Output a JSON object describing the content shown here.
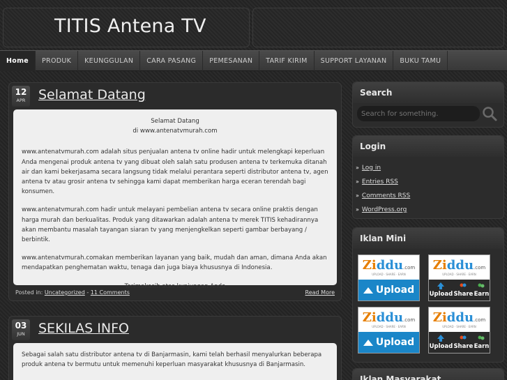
{
  "site": {
    "title": "TITIS Antena TV"
  },
  "nav": {
    "items": [
      "Home",
      "PRODUK",
      "KEUNGGULAN",
      "CARA PASANG",
      "PEMESANAN",
      "TARIF KIRIM",
      "SUPPORT LAYANAN",
      "BUKU TAMU"
    ],
    "active": "Home"
  },
  "posts": [
    {
      "day": "12",
      "month": "APR",
      "title": "Selamat Datang",
      "greeting_1": "Selamat Datang",
      "greeting_2": "di www.antenatvmurah.com",
      "para_1": "www.antenatvmurah.com adalah situs penjualan antena tv online hadir untuk melengkapi keperluan Anda mengenai produk antena tv yang dibuat oleh salah satu produsen antena tv terkemuka ditanah air  dan  kami bekerjasama secara langsung tidak melalui perantara seperti distributor antena tv, agen antena tv atau grosir antena tv sehingga kami dapat memberikan harga eceran terendah bagi konsumen.",
      "para_2": "www.antenatvmurah.com hadir untuk melayani pembelian antena tv secara online praktis dengan harga murah dan berkualitas. Produk yang ditawarkan adalah antena tv merek TITIS kehadirannya akan membantu masalah tayangan siaran tv yang menjengkelkan seperti gambar berbayang / berbintik.",
      "para_3": "www.antenatvmurah.comakan memberikan layanan yang baik, mudah dan aman, dimana Anda akan mendapatkan penghematan waktu, tenaga dan juga biaya khususnya di Indonesia.",
      "closing": "Terimakasih atas kunjungan Anda",
      "posted_in": "Posted in:",
      "category": "Uncategorized",
      "separator": " - ",
      "comments": "11 Comments",
      "read_more": "Read More"
    },
    {
      "day": "03",
      "month": "JUN",
      "title": "SEKILAS INFO",
      "para_1": "Sebagai salah satu distributor antena tv di Banjarmasin, kami telah berhasil menyalurkan beberapa produk antena tv bermutu untuk memenuhi keperluan masyarakat khususnya di Banjarmasin."
    }
  ],
  "sidebar": {
    "search": {
      "title": "Search",
      "placeholder": "Search for something."
    },
    "login": {
      "title": "Login",
      "bullet": "»",
      "links": [
        "Log in",
        "Entries RSS",
        "Comments RSS",
        "WordPress.org"
      ]
    },
    "iklan_mini": {
      "title": "Iklan Mini",
      "brand_a": "Zi",
      "brand_b": "ddu",
      "brand_com": ".com",
      "tagline": "UPLOAD · SHARE · EARN",
      "upload": "Upload",
      "share": "Share",
      "earn": "Earn"
    },
    "iklan_masyarakat": {
      "title": "Iklan Masyarakat"
    }
  }
}
